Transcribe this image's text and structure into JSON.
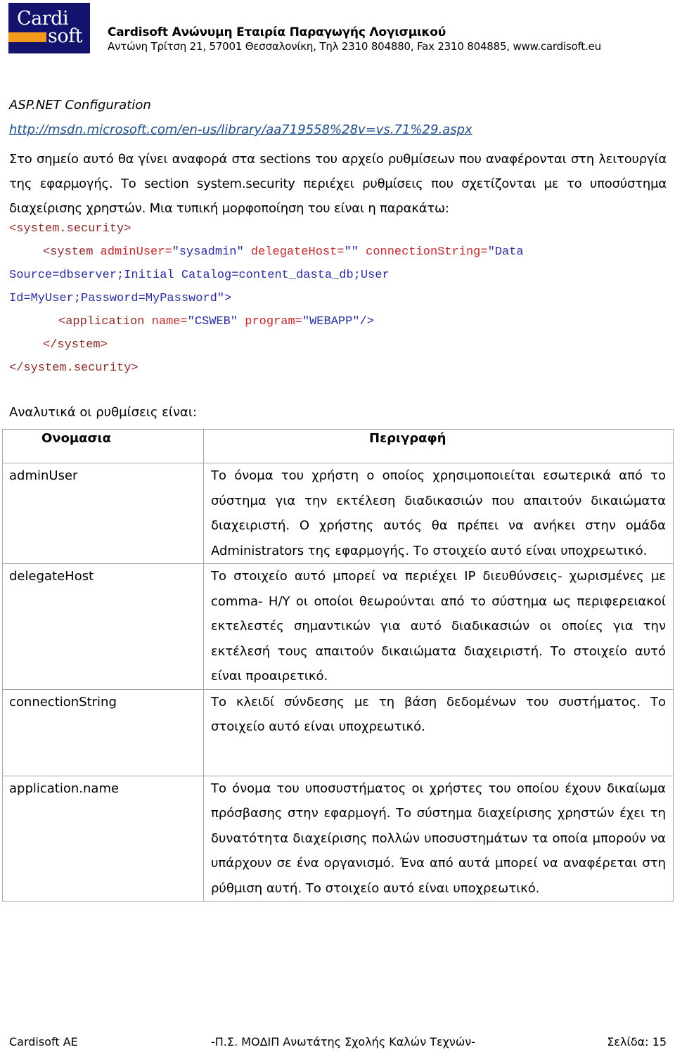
{
  "header": {
    "logo_line1": "Cardi",
    "logo_line2": "soft",
    "company": "Cardisoft Ανώνυμη Εταιρία Παραγωγής Λογισμικού",
    "address": "Αντώνη Τρίτση 21, 57001 Θεσσαλονίκη, Τηλ 2310 804880, Fax 2310 804885, www.cardisoft.eu",
    "colors": {
      "logo_bg": "#13136e",
      "logo_bar": "#f39a1c"
    }
  },
  "section": {
    "title": "ASP.NET Configuration",
    "link": "http://msdn.microsoft.com/en-us/library/aa719558%28v=vs.71%29.aspx",
    "paragraph": "Στο σημείο αυτό θα γίνει αναφορά στα sections του αρχείο ρυθμίσεων που αναφέρονται στη λειτουργία της εφαρμογής. Το section system.security περιέχει ρυθμίσεις που σχετίζονται με το υποσύστημα διαχείρισης χρηστών. Μια τυπική μορφοποίηση του είναι η παρακάτω:"
  },
  "code": {
    "line1": {
      "tag": "<system.security>"
    },
    "line2": {
      "open": "<system",
      "a1": "adminUser=",
      "v1": "\"sysadmin\"",
      "a2": "delegateHost=",
      "v2": "\"\"",
      "a3": "connectionString=",
      "v3": "\"Data"
    },
    "line3": "Source=dbserver;Initial Catalog=content_dasta_db;User",
    "line4": "Id=MyUser;Password=MyPassword\">",
    "line5": {
      "open": "<application",
      "a1": "name=",
      "v1": "\"CSWEB\"",
      "a2": "program=",
      "v2": "\"WEBAPP\"/>"
    },
    "line6": "</system>",
    "line7": "</system.security>",
    "colors": {
      "tag": "#8b2a2a",
      "attr": "#c0282c",
      "value": "#2a2d9c"
    }
  },
  "table": {
    "intro": "Αναλυτικά οι ρυθμίσεις είναι:",
    "headers": {
      "name": "Ονομασια",
      "description": "Περιγραφή"
    },
    "rows": [
      {
        "name": "adminUser",
        "description": "Το όνομα του χρήστη ο οποίος χρησιμοποιείται εσωτερικά από το σύστημα για την εκτέλεση διαδικασιών που απαιτούν δικαιώματα διαχειριστή. Ο χρήστης αυτός θα πρέπει να ανήκει στην ομάδα Administrators της εφαρμογής. Το στοιχείο αυτό είναι υποχρεωτικό."
      },
      {
        "name": "delegateHost",
        "description": "Το στοιχείο αυτό μπορεί να περιέχει IP διευθύνσεις- χωρισμένες με comma- Η/Υ οι οποίοι θεωρούνται από το σύστημα ως περιφερειακοί εκτελεστές σημαντικών για αυτό διαδικασιών οι οποίες για την εκτέλεσή τους απαιτούν δικαιώματα διαχειριστή. Το στοιχείο αυτό είναι προαιρετικό."
      },
      {
        "name": "connectionString",
        "description": "Το κλειδί σύνδεσης με τη βάση δεδομένων του συστήματος. Το στοιχείο αυτό είναι υποχρεωτικό."
      },
      {
        "name": "application.name",
        "description": "Το όνομα του υποσυστήματος οι χρήστες του οποίου έχουν δικαίωμα πρόσβασης στην εφαρμογή. Το σύστημα διαχείρισης χρηστών έχει τη δυνατότητα διαχείρισης πολλών υποσυστημάτων τα οποία μπορούν να υπάρχουν σε ένα οργανισμό. Ένα από αυτά μπορεί να αναφέρεται στη ρύθμιση αυτή. Το στοιχείο αυτό είναι υποχρεωτικό."
      }
    ]
  },
  "footer": {
    "left": "Cardisoft AE",
    "center": "-Π.Σ. ΜΟΔΙΠ Ανωτάτης Σχολής Καλών Τεχνών-",
    "right": "Σελίδα: 15"
  }
}
